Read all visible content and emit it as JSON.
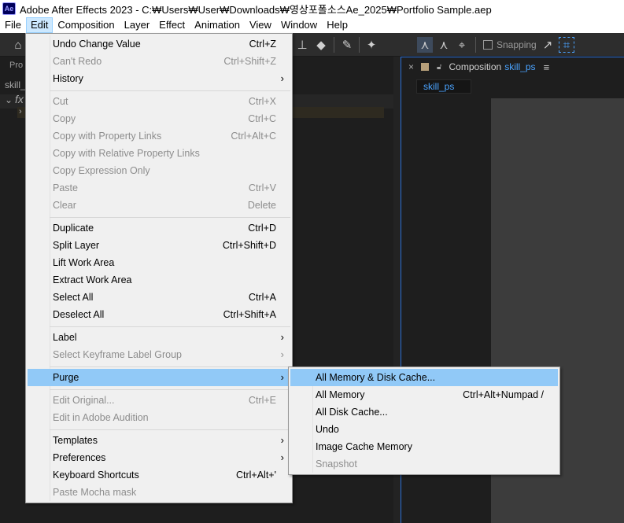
{
  "window": {
    "title": "Adobe After Effects 2023 - C:₩Users₩User₩Downloads₩영상포폴소스Ae_2025₩Portfolio Sample.aep",
    "logo": "Ae"
  },
  "menubar": {
    "items": [
      {
        "label": "File"
      },
      {
        "label": "Edit"
      },
      {
        "label": "Composition"
      },
      {
        "label": "Layer"
      },
      {
        "label": "Effect"
      },
      {
        "label": "Animation"
      },
      {
        "label": "View"
      },
      {
        "label": "Window"
      },
      {
        "label": "Help"
      }
    ],
    "active": "Edit"
  },
  "toolbar": {
    "snapping_label": "Snapping"
  },
  "left_panel": {
    "tab_label": "Pro",
    "item_label": "skill_",
    "fx_label": "fx"
  },
  "composition_panel": {
    "tab_prefix": "Composition",
    "comp_name": "skill_ps",
    "subtab": "skill_ps"
  },
  "edit_menu": {
    "items": [
      {
        "label": "Undo Change Value",
        "shortcut": "Ctrl+Z",
        "enabled": true
      },
      {
        "label": "Can't Redo",
        "shortcut": "Ctrl+Shift+Z",
        "enabled": false
      },
      {
        "label": "History",
        "shortcut": "",
        "enabled": true,
        "submenu": true
      },
      {
        "label": "Cut",
        "shortcut": "Ctrl+X",
        "enabled": false
      },
      {
        "label": "Copy",
        "shortcut": "Ctrl+C",
        "enabled": false
      },
      {
        "label": "Copy with Property Links",
        "shortcut": "Ctrl+Alt+C",
        "enabled": false
      },
      {
        "label": "Copy with Relative Property Links",
        "shortcut": "",
        "enabled": false
      },
      {
        "label": "Copy Expression Only",
        "shortcut": "",
        "enabled": false
      },
      {
        "label": "Paste",
        "shortcut": "Ctrl+V",
        "enabled": false
      },
      {
        "label": "Clear",
        "shortcut": "Delete",
        "enabled": false
      },
      {
        "label": "Duplicate",
        "shortcut": "Ctrl+D",
        "enabled": true
      },
      {
        "label": "Split Layer",
        "shortcut": "Ctrl+Shift+D",
        "enabled": true
      },
      {
        "label": "Lift Work Area",
        "shortcut": "",
        "enabled": true
      },
      {
        "label": "Extract Work Area",
        "shortcut": "",
        "enabled": true
      },
      {
        "label": "Select All",
        "shortcut": "Ctrl+A",
        "enabled": true
      },
      {
        "label": "Deselect All",
        "shortcut": "Ctrl+Shift+A",
        "enabled": true
      },
      {
        "label": "Label",
        "shortcut": "",
        "enabled": true,
        "submenu": true
      },
      {
        "label": "Select Keyframe Label Group",
        "shortcut": "",
        "enabled": false,
        "submenu": true
      },
      {
        "label": "Purge",
        "shortcut": "",
        "enabled": true,
        "submenu": true,
        "highlighted": true
      },
      {
        "label": "Edit Original...",
        "shortcut": "Ctrl+E",
        "enabled": false
      },
      {
        "label": "Edit in Adobe Audition",
        "shortcut": "",
        "enabled": false
      },
      {
        "label": "Templates",
        "shortcut": "",
        "enabled": true,
        "submenu": true
      },
      {
        "label": "Preferences",
        "shortcut": "",
        "enabled": true,
        "submenu": true
      },
      {
        "label": "Keyboard Shortcuts",
        "shortcut": "Ctrl+Alt+'",
        "enabled": true
      },
      {
        "label": "Paste Mocha mask",
        "shortcut": "",
        "enabled": false
      }
    ]
  },
  "purge_menu": {
    "items": [
      {
        "label": "All Memory & Disk Cache...",
        "shortcut": "",
        "enabled": true,
        "highlighted": true
      },
      {
        "label": "All Memory",
        "shortcut": "Ctrl+Alt+Numpad /",
        "enabled": true
      },
      {
        "label": "All Disk Cache...",
        "shortcut": "",
        "enabled": true
      },
      {
        "label": "Undo",
        "shortcut": "",
        "enabled": true
      },
      {
        "label": "Image Cache Memory",
        "shortcut": "",
        "enabled": true
      },
      {
        "label": "Snapshot",
        "shortcut": "",
        "enabled": false
      }
    ]
  }
}
